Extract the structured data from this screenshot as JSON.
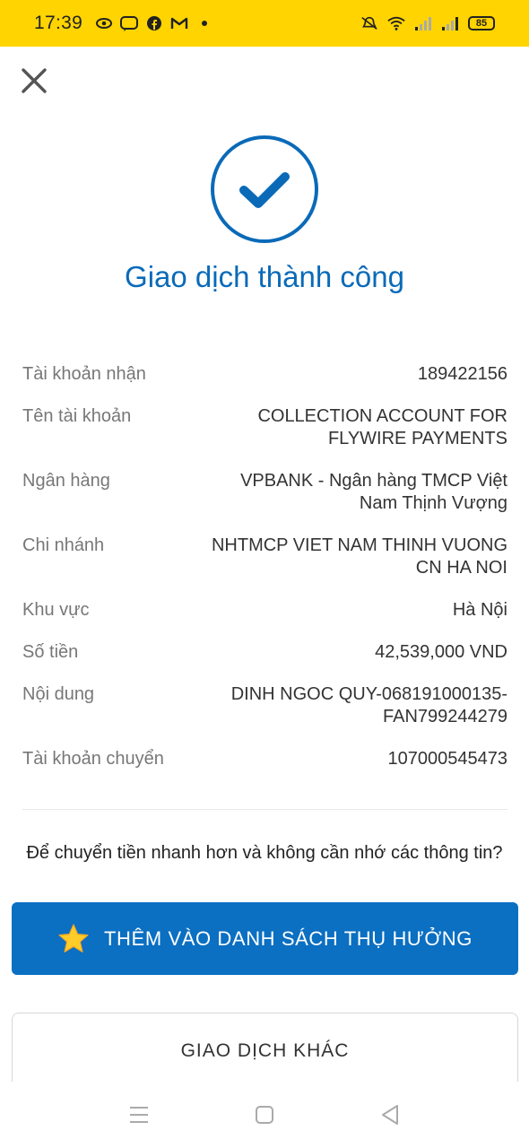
{
  "status_bar": {
    "time": "17:39",
    "battery": "85",
    "icons": [
      "eye-icon",
      "zalo-icon",
      "facebook-icon",
      "gmail-icon",
      "dot-icon",
      "mute-icon",
      "wifi-icon",
      "signal-icon",
      "signal-icon-2",
      "battery-icon"
    ],
    "background": "#ffd400"
  },
  "header": {
    "close_icon": "close-icon"
  },
  "result": {
    "title": "Giao dịch thành công",
    "icon": "check-circle-icon",
    "accent": "#0a6ab8"
  },
  "details": [
    {
      "label": "Tài khoản nhận",
      "value": "189422156"
    },
    {
      "label": "Tên tài khoản",
      "value": "COLLECTION ACCOUNT FOR FLYWIRE PAYMENTS"
    },
    {
      "label": "Ngân hàng",
      "value": "VPBANK - Ngân hàng TMCP Việt Nam Thịnh Vượng"
    },
    {
      "label": "Chi nhánh",
      "value": "NHTMCP VIET NAM THINH VUONG CN HA NOI"
    },
    {
      "label": "Khu vực",
      "value": "Hà Nội"
    },
    {
      "label": "Số tiền",
      "value": "42,539,000 VND"
    },
    {
      "label": "Nội dung",
      "value": "DINH NGOC QUY-068191000135-FAN799244279"
    },
    {
      "label": "Tài khoản chuyển",
      "value": "107000545473"
    }
  ],
  "prompt": "Để chuyển tiền nhanh hơn và không cần nhớ các thông tin?",
  "actions": {
    "add_beneficiary": "THÊM VÀO DANH SÁCH THỤ HƯỞNG",
    "other_transaction": "GIAO DỊCH KHÁC",
    "primary_color": "#0b6fc2"
  },
  "nav": {
    "icons": [
      "menu-icon",
      "home-icon",
      "back-icon"
    ]
  }
}
